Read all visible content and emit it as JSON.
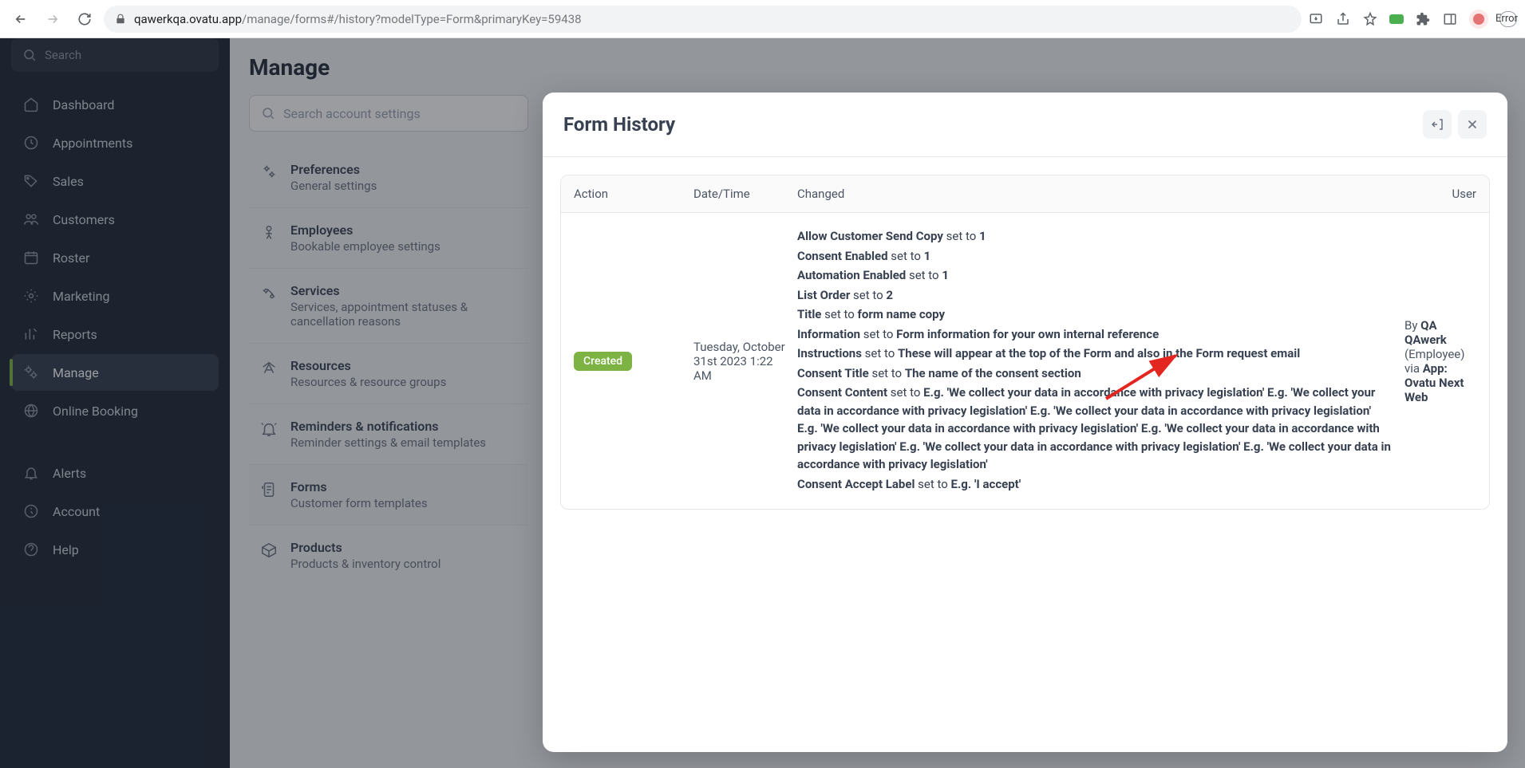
{
  "browser": {
    "url_domain": "qawerkqa.ovatu.app",
    "url_path": "/manage/forms#/history?modelType=Form&primaryKey=59438",
    "error_label": "Error"
  },
  "sidebar": {
    "search_placeholder": "Search",
    "items": [
      {
        "label": "Dashboard"
      },
      {
        "label": "Appointments"
      },
      {
        "label": "Sales"
      },
      {
        "label": "Customers"
      },
      {
        "label": "Roster"
      },
      {
        "label": "Marketing"
      },
      {
        "label": "Reports"
      },
      {
        "label": "Manage"
      },
      {
        "label": "Online Booking"
      }
    ],
    "footer": [
      {
        "label": "Alerts"
      },
      {
        "label": "Account"
      },
      {
        "label": "Help"
      }
    ]
  },
  "main": {
    "title": "Manage",
    "search_placeholder": "Search account settings",
    "settings": [
      {
        "title": "Preferences",
        "sub": "General settings"
      },
      {
        "title": "Employees",
        "sub": "Bookable employee settings"
      },
      {
        "title": "Services",
        "sub": "Services, appointment statuses & cancellation reasons"
      },
      {
        "title": "Resources",
        "sub": "Resources & resource groups"
      },
      {
        "title": "Reminders & notifications",
        "sub": "Reminder settings & email templates"
      },
      {
        "title": "Forms",
        "sub": "Customer form templates"
      },
      {
        "title": "Products",
        "sub": "Products & inventory control"
      }
    ]
  },
  "modal": {
    "title": "Form History",
    "columns": {
      "action": "Action",
      "datetime": "Date/Time",
      "changed": "Changed",
      "user": "User"
    },
    "row": {
      "action": "Created",
      "datetime": "Tuesday, October 31st 2023 1:22 AM",
      "changes": [
        {
          "field": "Allow Customer Send Copy",
          "verb": " set to ",
          "value": "1"
        },
        {
          "field": "Consent Enabled",
          "verb": " set to ",
          "value": "1"
        },
        {
          "field": "Automation Enabled",
          "verb": " set to ",
          "value": "1"
        },
        {
          "field": "List Order",
          "verb": " set to ",
          "value": "2"
        },
        {
          "field": "Title",
          "verb": " set to ",
          "value": "form name copy"
        },
        {
          "field": "Information",
          "verb": " set to ",
          "value": "Form information for your own internal reference"
        },
        {
          "field": "Instructions",
          "verb": " set to ",
          "value": "These will appear at the top of the Form and also in the Form request email"
        },
        {
          "field": "Consent Title",
          "verb": " set to ",
          "value": "The name of the consent section"
        },
        {
          "field": "Consent Content",
          "verb": " set to ",
          "value": "E.g. 'We collect your data in accordance with privacy legislation' E.g. 'We collect your data in accordance with privacy legislation' E.g. 'We collect your data in accordance with privacy legislation' E.g. 'We collect your data in accordance with privacy legislation' E.g. 'We collect your data in accordance with privacy legislation' E.g. 'We collect your data in accordance with privacy legislation' E.g. 'We collect your data in accordance with privacy legislation'"
        },
        {
          "field": "Consent Accept Label",
          "verb": " set to ",
          "value": "E.g. 'I accept'"
        }
      ],
      "user": {
        "by": "By ",
        "name": "QA QAwerk",
        "role": " (Employee) via ",
        "app": "App: Ovatu Next Web"
      }
    }
  }
}
